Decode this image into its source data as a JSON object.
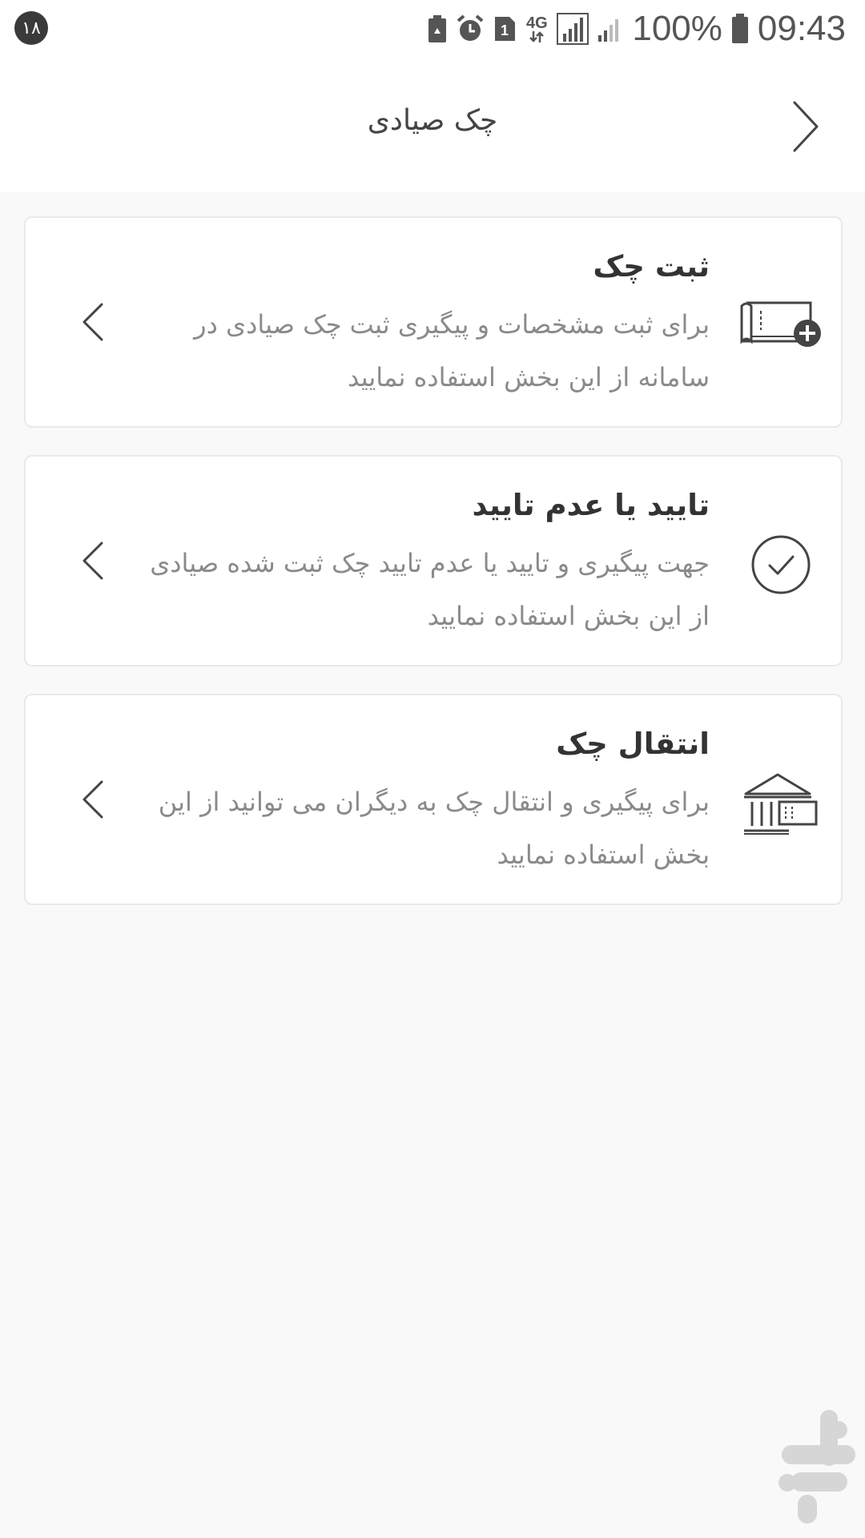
{
  "status_bar": {
    "notification_count": "۱۸",
    "network": "4G",
    "battery": "100%",
    "time": "09:43",
    "sim_slot": "1"
  },
  "header": {
    "title": "چک صیادی",
    "back_icon": "chevron-right-icon"
  },
  "cards": [
    {
      "title": "ثبت چک",
      "description": "برای ثبت مشخصات و پیگیری ثبت چک صیادی در سامانه از این بخش استفاده نمایید",
      "icon": "check-add-icon"
    },
    {
      "title": "تایید یا عدم تایید",
      "description": "جهت پیگیری و تایید یا عدم تایید چک ثبت شده صیادی از این بخش استفاده نمایید",
      "icon": "circle-check-icon"
    },
    {
      "title": "انتقال چک",
      "description": "برای پیگیری و انتقال چک به دیگران می توانید از این بخش استفاده نمایید",
      "icon": "bank-check-icon"
    }
  ],
  "colors": {
    "background": "#f9f9f9",
    "card": "#ffffff",
    "title": "#333333",
    "description": "#8a8a8a",
    "icon": "#444444"
  }
}
